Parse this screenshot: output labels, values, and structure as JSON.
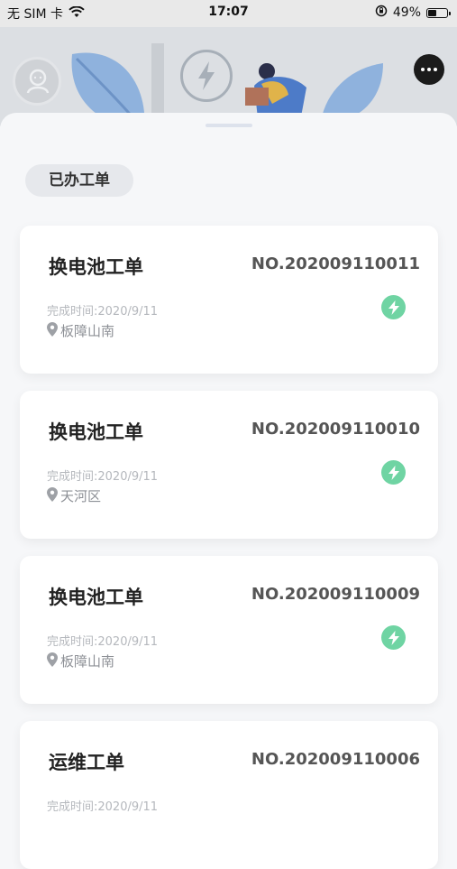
{
  "status_bar": {
    "carrier": "无 SIM 卡",
    "time": "17:07",
    "battery": "49%",
    "battery_level": 0.49
  },
  "header": {
    "avatar_icon": "user-avatar-icon",
    "chat_icon": "chat-bubble-icon"
  },
  "section": {
    "label": "已办工单"
  },
  "orders": [
    {
      "title": "换电池工单",
      "number": "NO.202009110011",
      "completed": "完成时间:2020/9/11",
      "location": "板障山南",
      "badge_icon": "bolt-icon"
    },
    {
      "title": "换电池工单",
      "number": "NO.202009110010",
      "completed": "完成时间:2020/9/11",
      "location": "天河区",
      "badge_icon": "bolt-icon"
    },
    {
      "title": "换电池工单",
      "number": "NO.202009110009",
      "completed": "完成时间:2020/9/11",
      "location": "板障山南",
      "badge_icon": "bolt-icon"
    },
    {
      "title": "运维工单",
      "number": "NO.202009110006",
      "completed": "完成时间:2020/9/11",
      "location": "",
      "badge_icon": ""
    }
  ],
  "colors": {
    "accent_green": "#6fd4a3",
    "background": "#f6f7f9"
  }
}
